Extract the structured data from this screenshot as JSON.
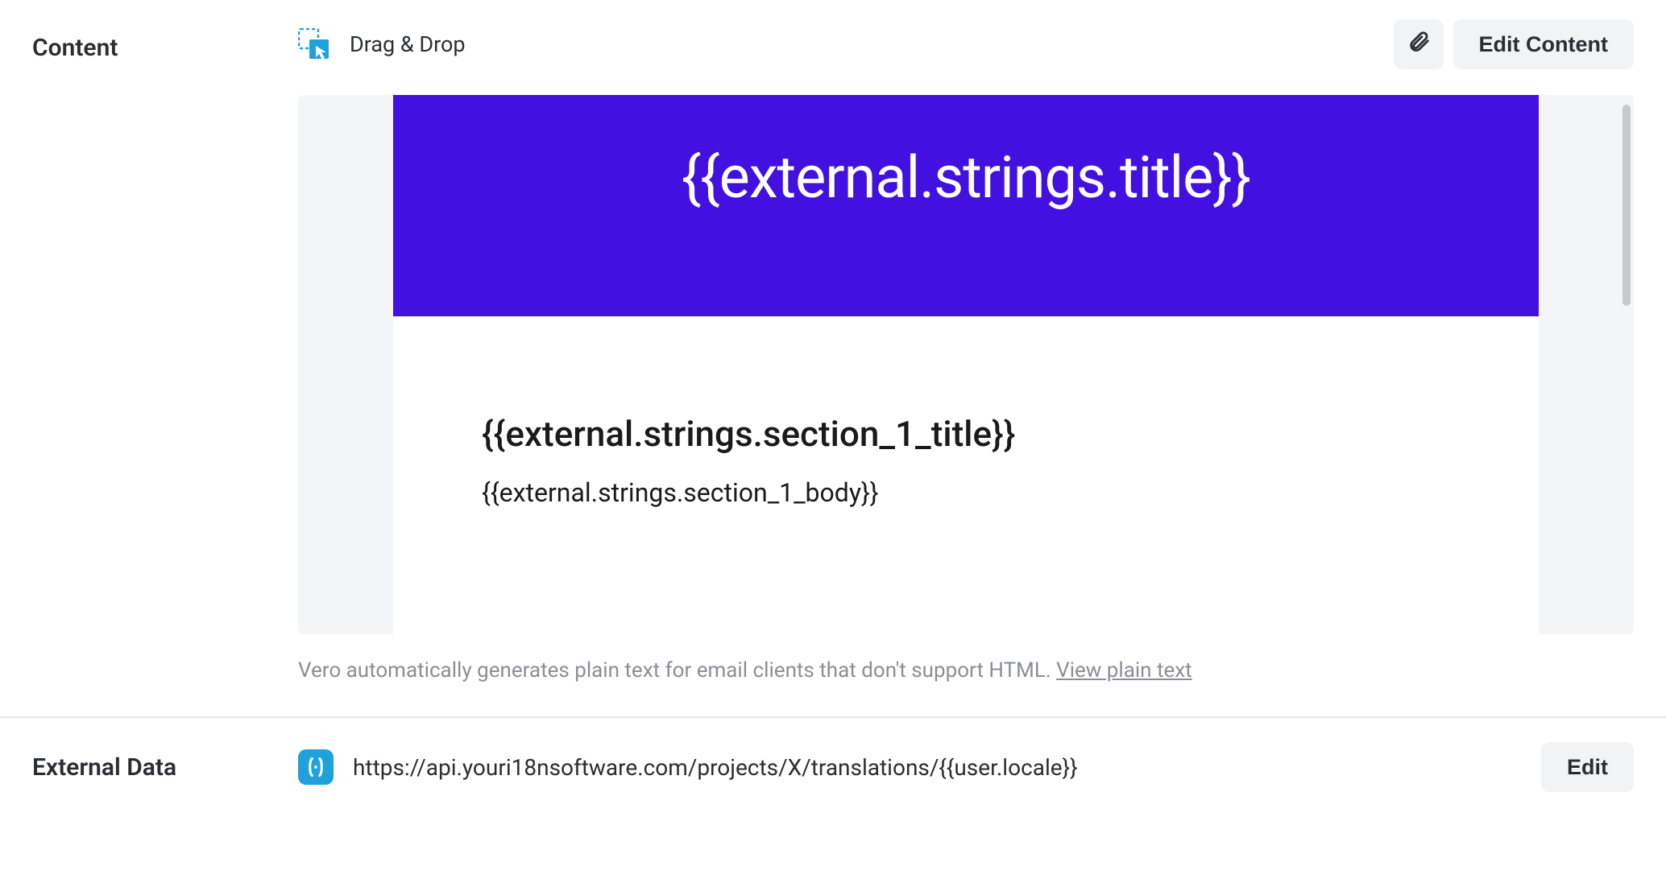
{
  "content": {
    "section_label": "Content",
    "drag_drop_label": "Drag & Drop",
    "edit_content_label": "Edit Content",
    "preview": {
      "hero_text": "{{external.strings.title}}",
      "section_1_title": "{{external.strings.section_1_title}}",
      "section_1_body": "{{external.strings.section_1_body}}"
    },
    "hint_text": "Vero automatically generates plain text for email clients that don't support HTML. ",
    "hint_link": "View plain text"
  },
  "external_data": {
    "section_label": "External Data",
    "url": "https://api.youri18nsoftware.com/projects/X/translations/{{user.locale}}",
    "edit_label": "Edit"
  }
}
